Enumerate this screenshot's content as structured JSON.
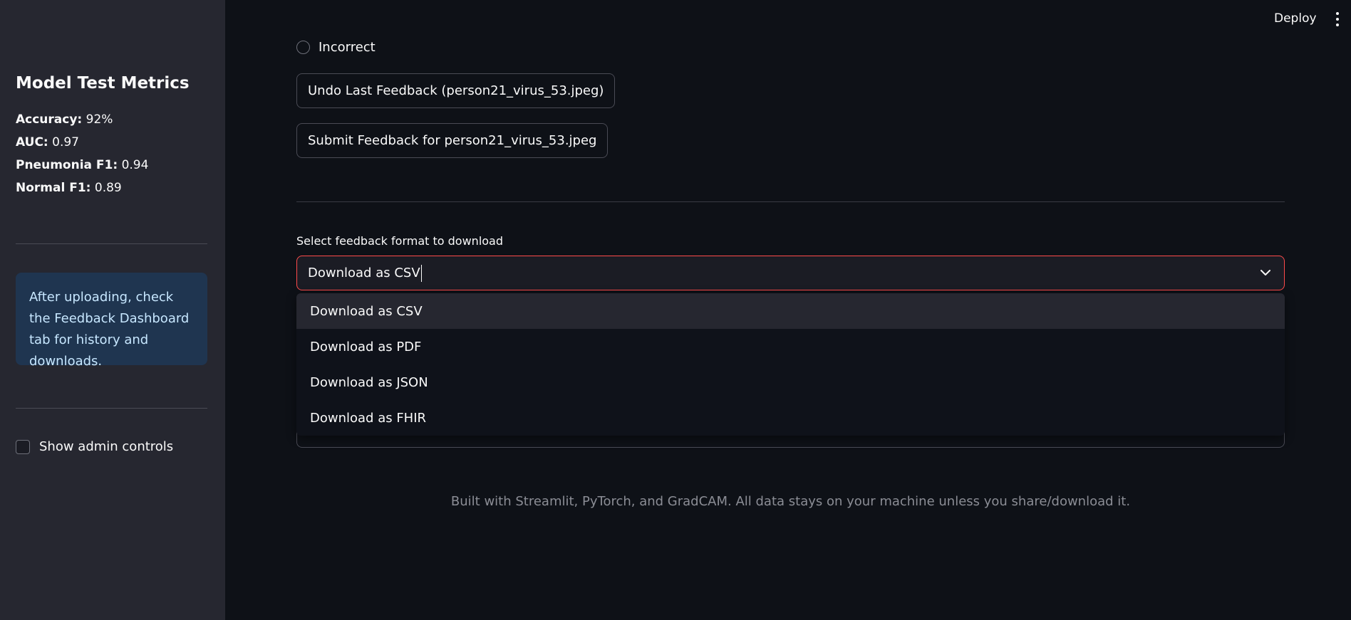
{
  "header": {
    "deploy_label": "Deploy"
  },
  "sidebar": {
    "title": "Model Test Metrics",
    "metrics": [
      {
        "label": "Accuracy:",
        "value": "92%"
      },
      {
        "label": "AUC:",
        "value": "0.97"
      },
      {
        "label": "Pneumonia F1:",
        "value": "0.94"
      },
      {
        "label": "Normal F1:",
        "value": "0.89"
      }
    ],
    "info_text": "After uploading, check the Feedback Dashboard tab for history and downloads.",
    "admin_checkbox_label": "Show admin controls"
  },
  "main": {
    "radio_option_label": "Incorrect",
    "undo_button_label": "Undo Last Feedback (person21_virus_53.jpeg)",
    "submit_button_label": "Submit Feedback for person21_virus_53.jpeg",
    "select_label": "Select feedback format to download",
    "select_value": "Download as CSV",
    "options": [
      "Download as CSV",
      "Download as PDF",
      "Download as JSON",
      "Download as FHIR"
    ],
    "footer_text": "Built with Streamlit, PyTorch, and GradCAM. All data stays on your machine unless you share/download it."
  },
  "colors": {
    "background": "#0e1117",
    "sidebar": "#262730",
    "accent_focus": "#ff4b4b",
    "info_bg": "#1f3550",
    "info_text": "#c7e7ff"
  },
  "icons": {
    "menu": "kebab-menu-icon",
    "select": "chevron-down-icon"
  }
}
